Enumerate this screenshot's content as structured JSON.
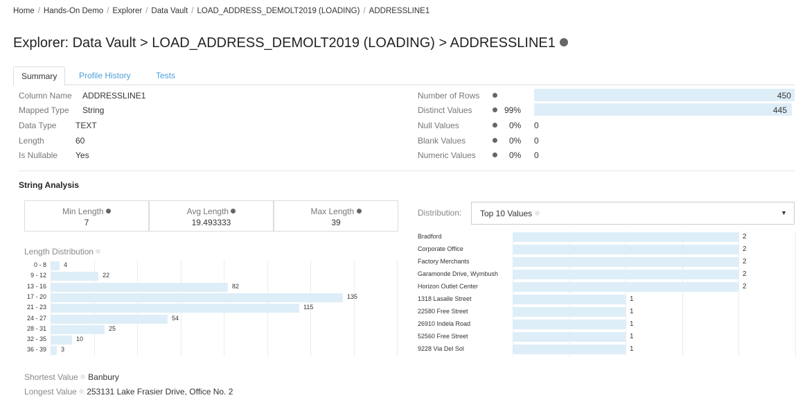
{
  "breadcrumb": [
    "Home",
    "Hands-On Demo",
    "Explorer",
    "Data Vault",
    "LOAD_ADDRESS_DEMOLT2019 (LOADING)",
    "ADDRESSLINE1"
  ],
  "title": "Explorer: Data Vault > LOAD_ADDRESS_DEMOLT2019 (LOADING) > ADDRESSLINE1",
  "tabs": [
    {
      "label": "Summary",
      "active": true
    },
    {
      "label": "Profile History",
      "active": false
    },
    {
      "label": "Tests",
      "active": false
    }
  ],
  "column_info": [
    {
      "key": "Column Name",
      "value": "ADDRESSLINE1"
    },
    {
      "key": "Mapped Type",
      "value": "String"
    },
    {
      "key": "Data Type",
      "value": "TEXT"
    },
    {
      "key": "Length",
      "value": "60"
    },
    {
      "key": "Is Nullable",
      "value": "Yes"
    }
  ],
  "stats": [
    {
      "key": "Number of Rows",
      "pct": "",
      "value": "450",
      "fraction": 1.0
    },
    {
      "key": "Distinct Values",
      "pct": "99%",
      "value": "445",
      "fraction": 0.9889
    },
    {
      "key": "Null Values",
      "pct": "0%",
      "value": "0",
      "fraction": 0
    },
    {
      "key": "Blank Values",
      "pct": "0%",
      "value": "0",
      "fraction": 0
    },
    {
      "key": "Numeric Values",
      "pct": "0%",
      "value": "0",
      "fraction": 0
    }
  ],
  "string_analysis": {
    "title": "String Analysis",
    "min_label": "Min Length",
    "min_value": "7",
    "avg_label": "Avg Length",
    "avg_value": "19.493333",
    "max_label": "Max Length",
    "max_value": "39"
  },
  "length_distribution": {
    "label": "Length Distribution",
    "max": 135,
    "rows": [
      {
        "range": "0 - 8",
        "count": 4
      },
      {
        "range": "9 - 12",
        "count": 22
      },
      {
        "range": "13 - 16",
        "count": 82
      },
      {
        "range": "17 - 20",
        "count": 135
      },
      {
        "range": "21 - 23",
        "count": 115
      },
      {
        "range": "24 - 27",
        "count": 54
      },
      {
        "range": "28 - 31",
        "count": 25
      },
      {
        "range": "32 - 35",
        "count": 10
      },
      {
        "range": "36 - 39",
        "count": 3
      }
    ]
  },
  "distribution": {
    "label": "Distribution:",
    "selected": "Top 10 Values",
    "max": 2,
    "rows": [
      {
        "value": "Bradford",
        "count": 2
      },
      {
        "value": "Corporate Office",
        "count": 2
      },
      {
        "value": "Factory Merchants",
        "count": 2
      },
      {
        "value": "Garamonde Drive, Wymbush",
        "count": 2
      },
      {
        "value": "Horizon Outlet Center",
        "count": 2
      },
      {
        "value": "1318 Lasalle Street",
        "count": 1
      },
      {
        "value": "22580 Free Street",
        "count": 1
      },
      {
        "value": "26910 Indela Road",
        "count": 1
      },
      {
        "value": "52560 Free Street",
        "count": 1
      },
      {
        "value": "9228 Via Del Sol",
        "count": 1
      }
    ]
  },
  "shortest": {
    "label": "Shortest Value",
    "value": "Banbury"
  },
  "longest": {
    "label": "Longest Value",
    "value": "253131 Lake Frasier Drive, Office No. 2"
  },
  "colors": {
    "bar": "#deeef8",
    "link": "#4a9fd8",
    "dot": "#666666"
  }
}
